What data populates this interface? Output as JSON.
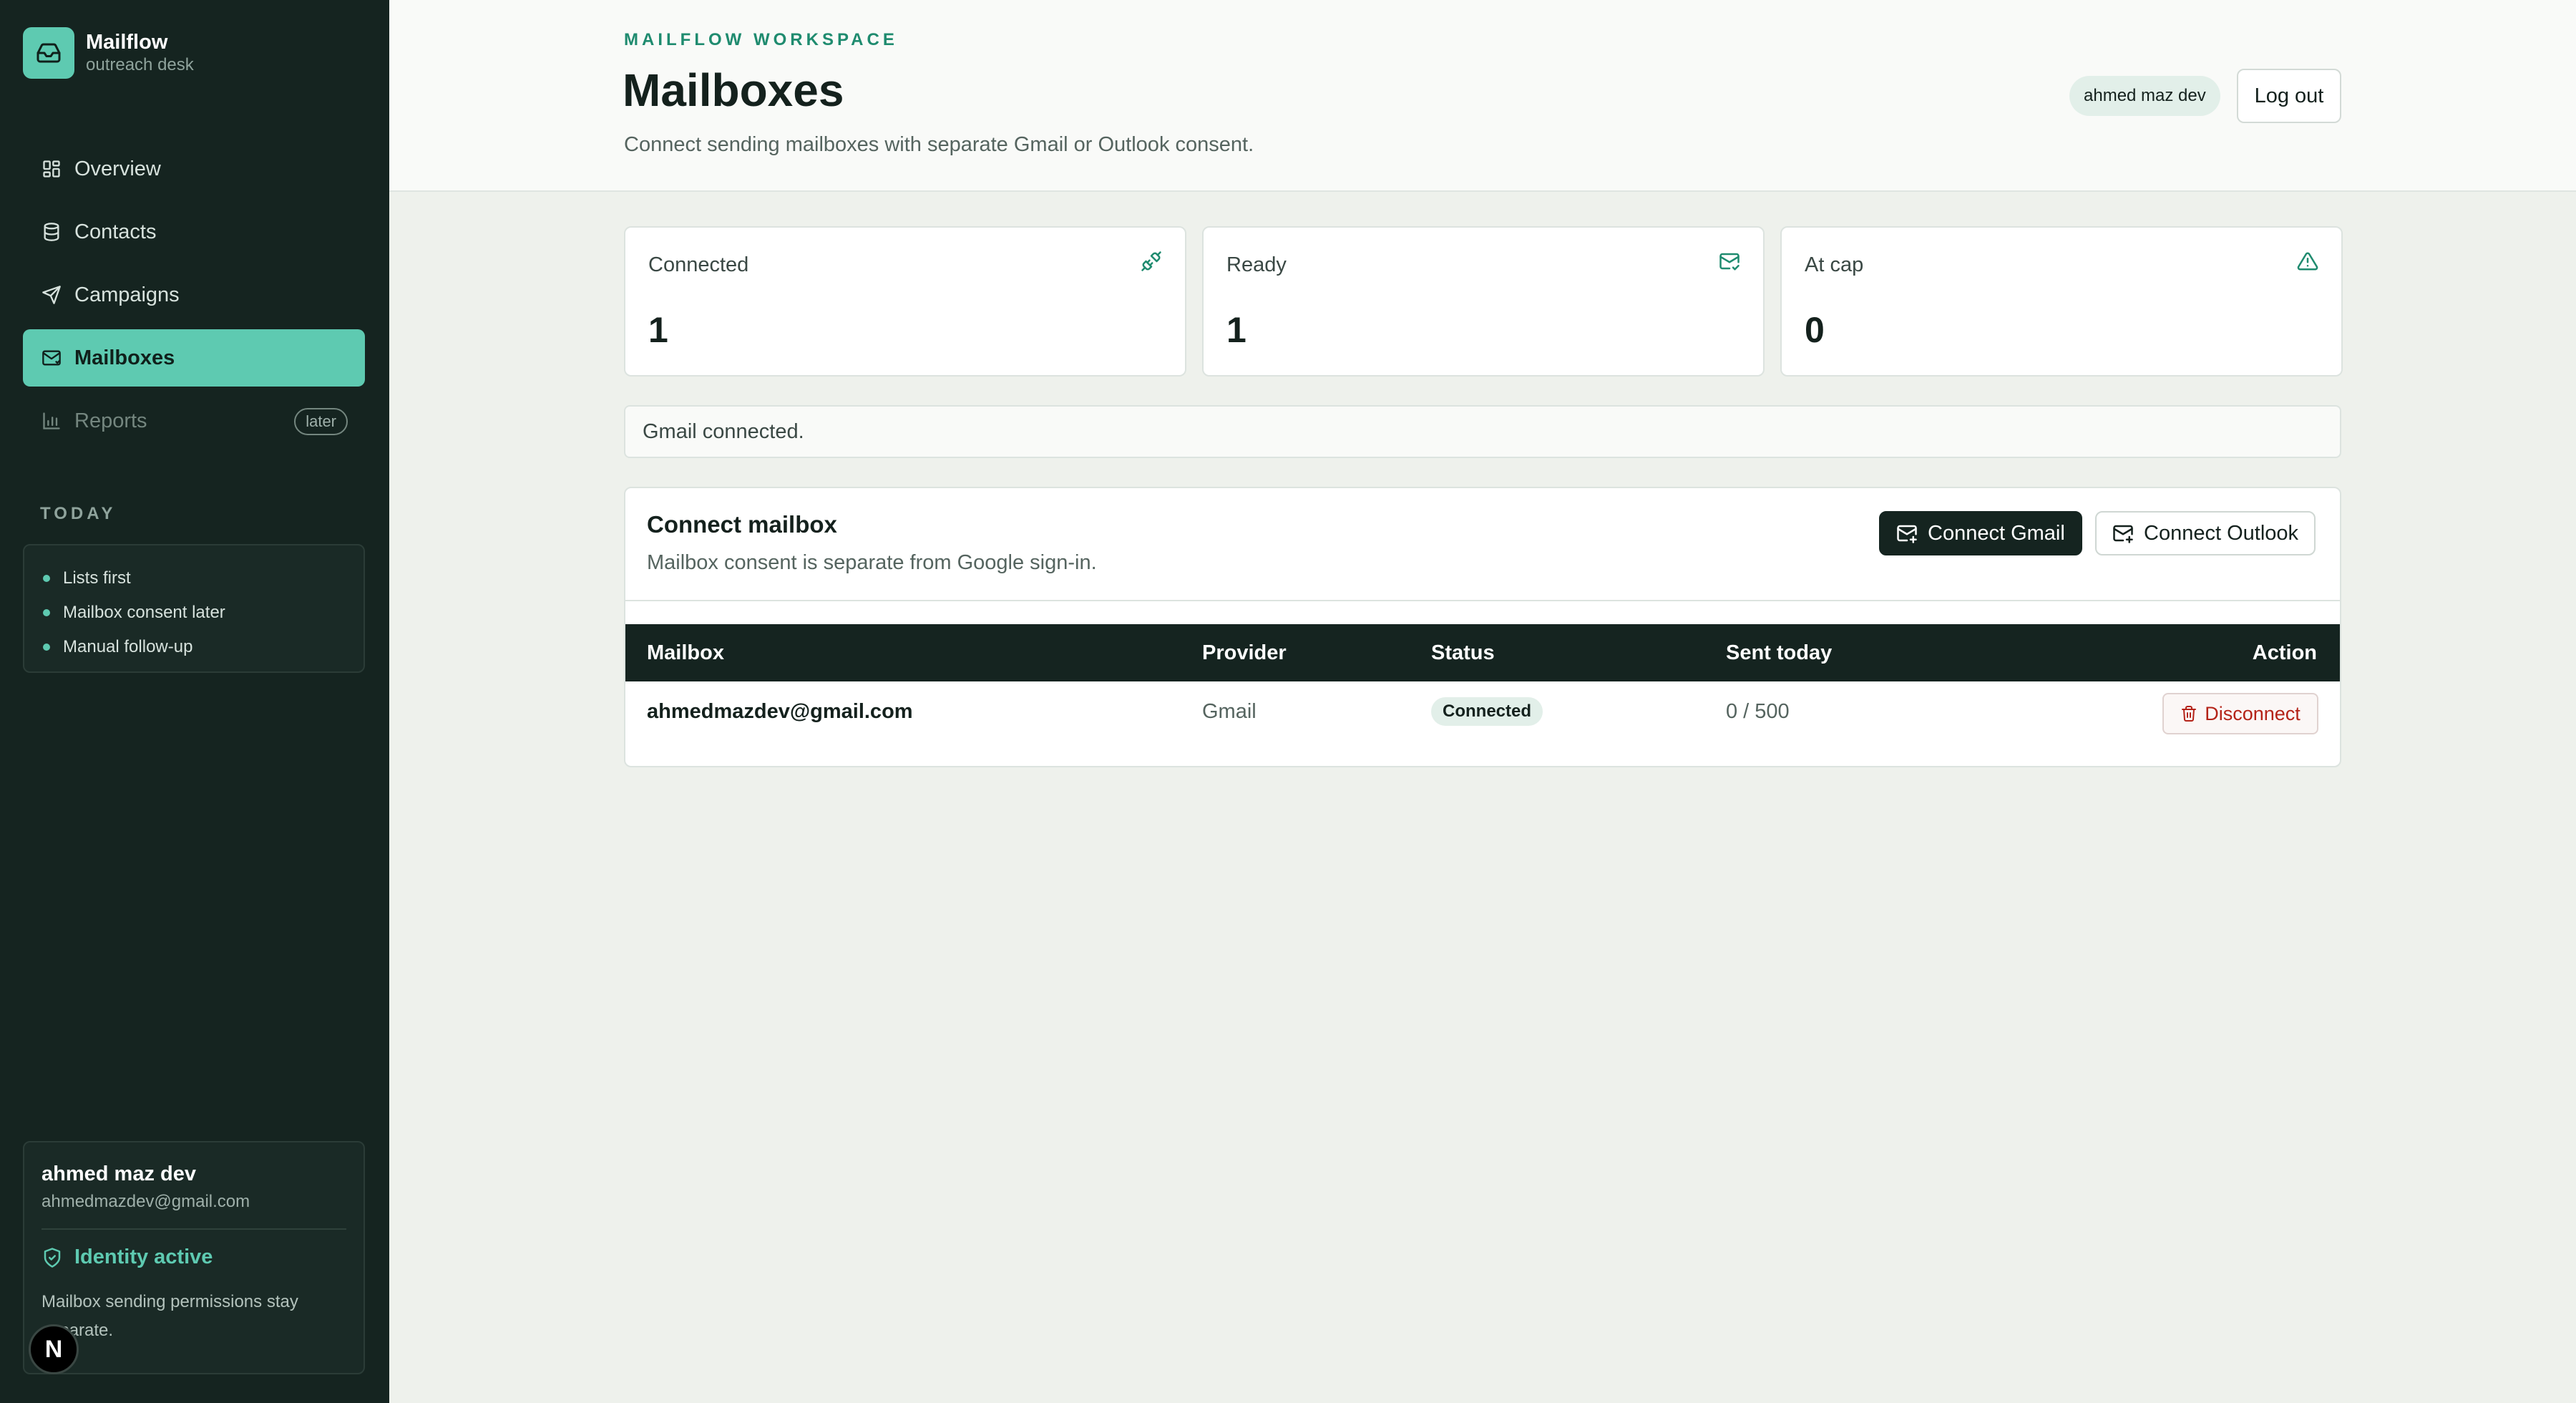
{
  "brand": {
    "name": "Mailflow",
    "subtitle": "outreach desk"
  },
  "sidebar": {
    "items": [
      {
        "label": "Overview",
        "icon": "grid-icon"
      },
      {
        "label": "Contacts",
        "icon": "database-icon"
      },
      {
        "label": "Campaigns",
        "icon": "send-icon"
      },
      {
        "label": "Mailboxes",
        "icon": "mail-icon",
        "active": true
      },
      {
        "label": "Reports",
        "icon": "bar-chart-icon",
        "badge": "later",
        "disabled": true
      }
    ],
    "today": {
      "label": "TODAY",
      "items": [
        "Lists first",
        "Mailbox consent later",
        "Manual follow-up"
      ]
    },
    "profile": {
      "name": "ahmed maz dev",
      "email": "ahmedmazdev@gmail.com",
      "identity": "Identity active",
      "note": "Mailbox sending permissions stay separate."
    },
    "n_badge": "N"
  },
  "header": {
    "eyebrow": "MAILFLOW WORKSPACE",
    "title": "Mailboxes",
    "subtitle": "Connect sending mailboxes with separate Gmail or Outlook consent.",
    "user_chip": "ahmed maz dev",
    "logout_label": "Log out"
  },
  "stats": [
    {
      "label": "Connected",
      "value": "1",
      "icon": "plug-icon"
    },
    {
      "label": "Ready",
      "value": "1",
      "icon": "mail-check-icon"
    },
    {
      "label": "At cap",
      "value": "0",
      "icon": "warning-icon"
    }
  ],
  "notice": "Gmail connected.",
  "connect": {
    "title": "Connect mailbox",
    "subtitle": "Mailbox consent is separate from Google sign-in.",
    "gmail_label": "Connect Gmail",
    "outlook_label": "Connect Outlook"
  },
  "table": {
    "columns": [
      "Mailbox",
      "Provider",
      "Status",
      "Sent today",
      "Action"
    ],
    "rows": [
      {
        "mailbox": "ahmedmazdev@gmail.com",
        "provider": "Gmail",
        "status": "Connected",
        "sent_today": "0 / 500",
        "action": "Disconnect"
      }
    ]
  },
  "colors": {
    "accent": "#5ecab1",
    "sidebar_bg": "#152420",
    "eyebrow": "#1f8b6f",
    "danger": "#b42318"
  }
}
